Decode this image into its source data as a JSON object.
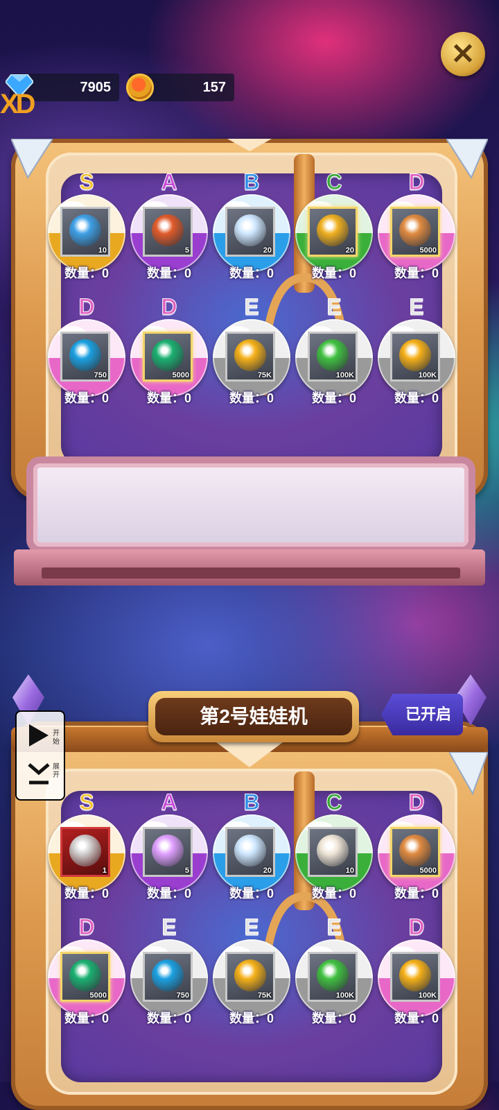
{
  "currency": {
    "gems": {
      "icon": "diamond-icon",
      "value": "7905"
    },
    "coins": {
      "icon": "coin-icon",
      "value": "157"
    }
  },
  "corner_logo": "XD",
  "close_icon": "close-icon",
  "qty_label": "数量：",
  "machine1": {
    "slots": [
      {
        "grade": "S",
        "grade_color": "#f2c12e",
        "ball": "#e8a820",
        "icon": "orb-icon",
        "icon_color": "#3ea0e6",
        "count": "10",
        "qty": "0",
        "frame": "normal"
      },
      {
        "grade": "A",
        "grade_color": "#c84ad8",
        "ball": "#9a3ed0",
        "icon": "rune-stone-icon",
        "icon_color": "#e05a2a",
        "count": "5",
        "qty": "0",
        "frame": "normal"
      },
      {
        "grade": "B",
        "grade_color": "#2f8fe6",
        "ball": "#2a9ee8",
        "icon": "egg-icon",
        "icon_color": "#cfe8ff",
        "count": "20",
        "qty": "0",
        "frame": "normal"
      },
      {
        "grade": "C",
        "grade_color": "#3aa83a",
        "ball": "#3ab03a",
        "icon": "crystal-icon",
        "icon_color": "#f0b020",
        "count": "20",
        "qty": "0",
        "frame": "gold"
      },
      {
        "grade": "D",
        "grade_color": "#e060c0",
        "ball": "#e868c8",
        "icon": "bone-biscuit-icon",
        "icon_color": "#e08a40",
        "count": "5000",
        "qty": "0",
        "frame": "gold"
      },
      {
        "grade": "D",
        "grade_color": "#e060c0",
        "ball": "#e868c8",
        "icon": "blue-orb-icon",
        "icon_color": "#1aa0e0",
        "count": "750",
        "qty": "0",
        "frame": "normal"
      },
      {
        "grade": "D",
        "grade_color": "#e060c0",
        "ball": "#e868c8",
        "icon": "green-gem-icon",
        "icon_color": "#1ab070",
        "count": "5000",
        "qty": "0",
        "frame": "gold"
      },
      {
        "grade": "E",
        "grade_color": "#e4e4e4",
        "ball": "#9a9a9a",
        "icon": "gold-coin-icon",
        "icon_color": "#f5b018",
        "count": "75K",
        "qty": "0",
        "frame": "normal"
      },
      {
        "grade": "E",
        "grade_color": "#e4e4e4",
        "ball": "#9a9a9a",
        "icon": "potion-icon",
        "icon_color": "#40c040",
        "count": "100K",
        "qty": "0",
        "frame": "normal"
      },
      {
        "grade": "E",
        "grade_color": "#e4e4e4",
        "ball": "#9a9a9a",
        "icon": "gold-coin-icon",
        "icon_color": "#f5b018",
        "count": "100K",
        "qty": "0",
        "frame": "normal"
      }
    ]
  },
  "machine2": {
    "title": "第2号娃娃机",
    "status": "已开启",
    "side": {
      "start_label": "开始",
      "expand_label": "展开"
    },
    "slots": [
      {
        "grade": "S",
        "grade_color": "#f2c12e",
        "ball": "#e8a820",
        "icon": "claw-blade-icon",
        "icon_color": "#d0d0d0",
        "count": "1",
        "qty": "0",
        "frame": "red"
      },
      {
        "grade": "A",
        "grade_color": "#c84ad8",
        "ball": "#9a3ed0",
        "icon": "treasure-chest-icon",
        "icon_color": "#e0a0ff",
        "count": "5",
        "qty": "0",
        "frame": "normal"
      },
      {
        "grade": "B",
        "grade_color": "#2f8fe6",
        "ball": "#2a9ee8",
        "icon": "egg-icon",
        "icon_color": "#cfe8ff",
        "count": "20",
        "qty": "0",
        "frame": "normal"
      },
      {
        "grade": "C",
        "grade_color": "#3aa83a",
        "ball": "#3ab03a",
        "icon": "card-icon",
        "icon_color": "#f0e6d8",
        "count": "10",
        "qty": "0",
        "frame": "normal"
      },
      {
        "grade": "D",
        "grade_color": "#e060c0",
        "ball": "#e868c8",
        "icon": "bone-biscuit-icon",
        "icon_color": "#e08a40",
        "count": "5000",
        "qty": "0",
        "frame": "gold"
      },
      {
        "grade": "D",
        "grade_color": "#e060c0",
        "ball": "#e868c8",
        "icon": "green-gem-icon",
        "icon_color": "#1ab070",
        "count": "5000",
        "qty": "0",
        "frame": "gold"
      },
      {
        "grade": "E",
        "grade_color": "#e4e4e4",
        "ball": "#9a9a9a",
        "icon": "blue-orb-icon",
        "icon_color": "#1aa0e0",
        "count": "750",
        "qty": "0",
        "frame": "normal"
      },
      {
        "grade": "E",
        "grade_color": "#e4e4e4",
        "ball": "#9a9a9a",
        "icon": "gold-coin-icon",
        "icon_color": "#f5b018",
        "count": "75K",
        "qty": "0",
        "frame": "normal"
      },
      {
        "grade": "E",
        "grade_color": "#e4e4e4",
        "ball": "#9a9a9a",
        "icon": "potion-icon",
        "icon_color": "#40c040",
        "count": "100K",
        "qty": "0",
        "frame": "normal"
      },
      {
        "grade": "D",
        "grade_color": "#e060c0",
        "ball": "#e868c8",
        "icon": "gold-coin-icon",
        "icon_color": "#f5b018",
        "count": "100K",
        "qty": "0",
        "frame": "normal"
      }
    ]
  }
}
